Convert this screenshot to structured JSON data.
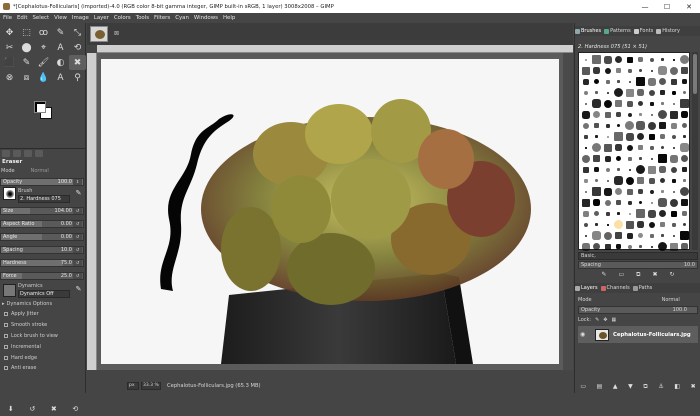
{
  "window": {
    "title": "*[Cephalotus-Follicularis] (imported)-4.0 (RGB color 8-bit gamma integer, GIMP built-in sRGB, 1 layer) 3008x2008 – GIMP",
    "minimize": "—",
    "maximize": "☐",
    "close": "✕"
  },
  "menu": [
    "File",
    "Edit",
    "Select",
    "View",
    "Image",
    "Layer",
    "Colors",
    "Tools",
    "Filters",
    "Cyan",
    "Windows",
    "Help"
  ],
  "toolbox": {
    "tools": [
      "✥",
      "⬚",
      "ꝏ",
      "✎",
      "⤡",
      "✂",
      "⬤",
      "⌖",
      "A",
      "⟲",
      "⬛",
      "✎",
      "🖌",
      "◐",
      "✖",
      "⊗",
      "⧈",
      "💧",
      "A",
      "⚲"
    ]
  },
  "tool_options": {
    "title": "Eraser",
    "mode_label": "Mode",
    "mode_value": "Normal",
    "opacity_label": "Opacity",
    "opacity_value": "100.0",
    "opacity_level": 1.0,
    "brush_label": "Brush",
    "brush_name": "2. Hardness 075",
    "size_label": "Size",
    "size_value": "104.00",
    "size_level": 0.35,
    "aspect_label": "Aspect Ratio",
    "aspect_value": "0.00",
    "aspect_level": 0.5,
    "angle_label": "Angle",
    "angle_value": "0.00",
    "angle_level": 0.5,
    "spacing_label": "Spacing",
    "spacing_value": "10.0",
    "spacing_level": 0.1,
    "hardness_label": "Hardness",
    "hardness_value": "75.0",
    "hardness_level": 0.75,
    "force_label": "Force",
    "force_value": "25.0",
    "force_level": 0.25,
    "dynamics_label": "Dynamics",
    "dynamics_name": "Dynamics Off",
    "dynamics_options": "Dynamics Options",
    "apply_jitter": "Apply Jitter",
    "smooth_stroke": "Smooth stroke",
    "lock_brush": "Lock brush to view",
    "incremental": "Incremental",
    "hard_edge": "Hard edge",
    "anti_erase": "Anti erase"
  },
  "image_window": {
    "status_unit": "px",
    "status_zoom": "33.3 %",
    "status_file": "Cephalotus-Folliculars.jpg (65.3 MB)"
  },
  "brushes_dock": {
    "tabs": [
      "Brushes",
      "Patterns",
      "Fonts",
      "History"
    ],
    "selected_brush": "2. Hardness 075 (51 × 51)",
    "tag_placeholder": "Basic,",
    "spacing_label": "Spacing",
    "spacing_value": "10.0"
  },
  "layers_dock": {
    "tabs": [
      "Layers",
      "Channels",
      "Paths"
    ],
    "mode_label": "Mode",
    "mode_value": "Normal",
    "opacity_label": "Opacity",
    "opacity_value": "100.0",
    "lock_label": "Lock:",
    "layer_name": "Cephalotus-Folliculars.jpg"
  }
}
